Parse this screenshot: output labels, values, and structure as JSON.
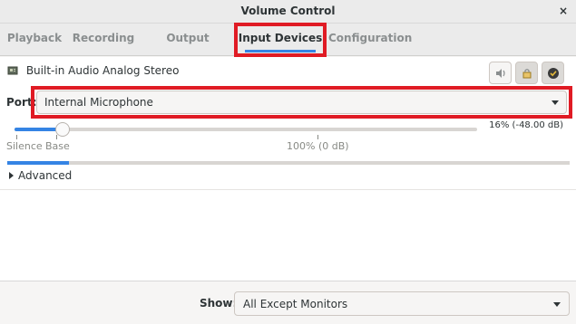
{
  "window": {
    "title": "Volume Control",
    "close_glyph": "×"
  },
  "tabs": [
    {
      "label": "Playback",
      "active": false
    },
    {
      "label": "Recording",
      "active": false
    },
    {
      "label": "Output Devices",
      "active": false
    },
    {
      "label": "Input Devices",
      "active": true
    },
    {
      "label": "Configuration",
      "active": false
    }
  ],
  "device": {
    "name": "Built-in Audio Analog Stereo",
    "icon": "sound-card-icon",
    "buttons": [
      {
        "name": "mute-button",
        "icon": "speaker-icon",
        "pressed": false
      },
      {
        "name": "lock-channels-button",
        "icon": "lock-icon",
        "pressed": true
      },
      {
        "name": "set-default-button",
        "icon": "checkmark-icon",
        "pressed": true
      }
    ]
  },
  "port": {
    "label": "Port:",
    "value": "Internal Microphone"
  },
  "volume": {
    "readout": "16% (-48.00 dB)",
    "percent": 16,
    "ticks": [
      "Silence",
      "Base",
      "100% (0 dB)"
    ]
  },
  "level_meter": {
    "fraction": 0.11
  },
  "advanced": {
    "label": "Advanced"
  },
  "footer": {
    "show_label": "Show:",
    "show_value": "All Except Monitors"
  },
  "colors": {
    "accent": "#3584e4",
    "highlight": "#e01b24"
  }
}
